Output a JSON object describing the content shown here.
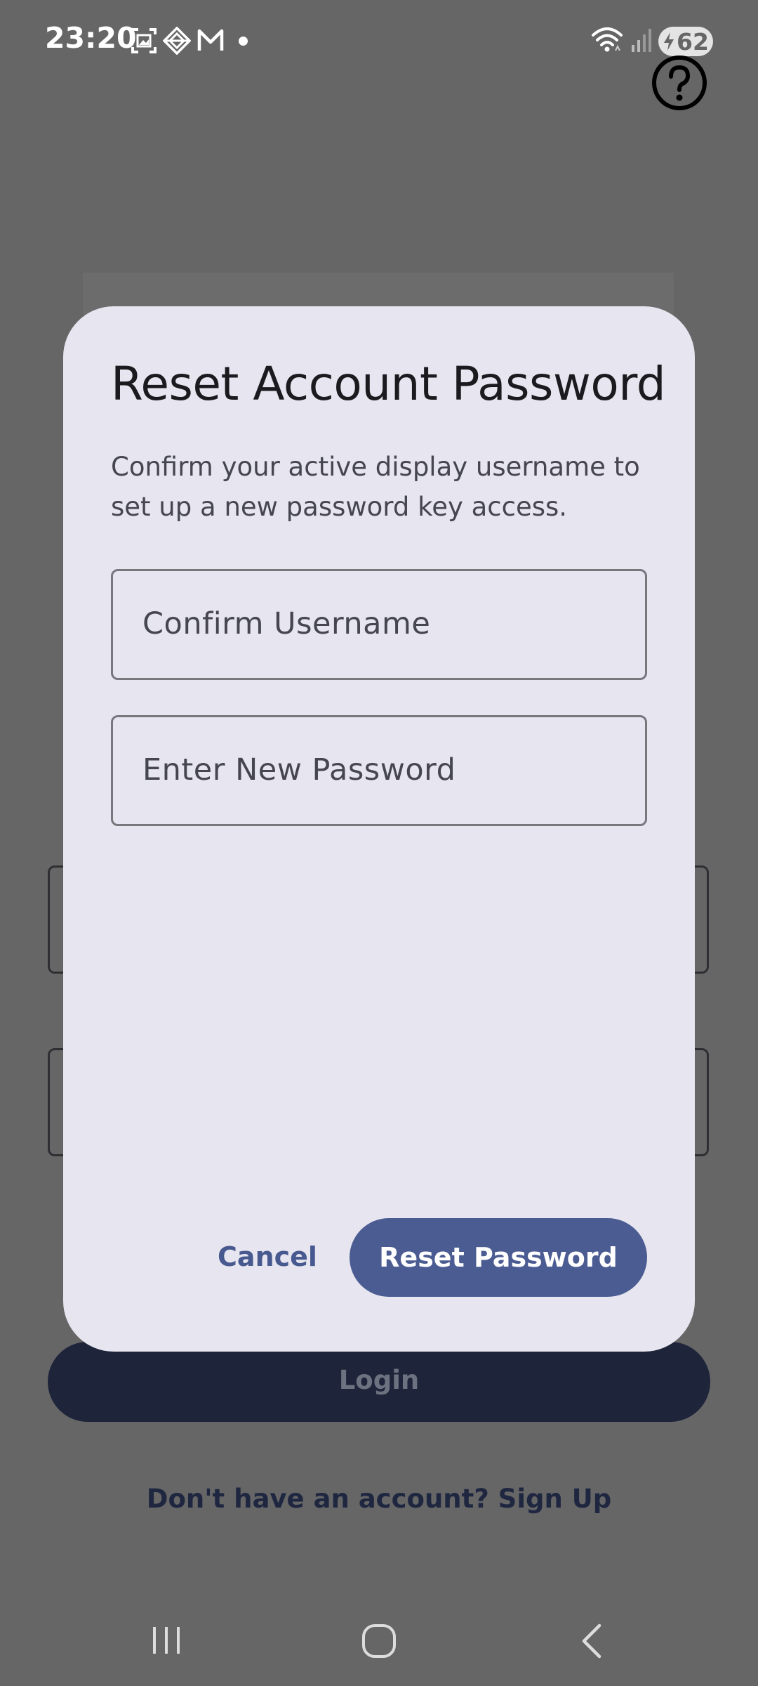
{
  "status_bar": {
    "time": "23:20",
    "battery_level": "62",
    "notification_icons": [
      "screenshot-icon",
      "diamond-app-icon",
      "gmail-icon",
      "more-dot-icon"
    ],
    "system_icons": [
      "wifi-icon",
      "signal-icon",
      "battery-charging-icon"
    ]
  },
  "header": {
    "help_icon": "help-circle-icon"
  },
  "background": {
    "login_button_label": "Login",
    "signup_prompt": "Don't have an account? Sign Up"
  },
  "dialog": {
    "title": "Reset Account Password",
    "message": "Confirm your active display username to set up a new password key access.",
    "username_field": {
      "placeholder": "Confirm Username",
      "value": ""
    },
    "password_field": {
      "placeholder": "Enter New Password",
      "value": ""
    },
    "cancel_label": "Cancel",
    "confirm_label": "Reset Password"
  },
  "colors": {
    "scrim": "#666667",
    "dialog_bg": "#e7e5ef",
    "primary": "#4a5c92",
    "login_button": "#1e253a"
  },
  "nav_bar": {
    "buttons": [
      "recent-apps-icon",
      "home-icon",
      "back-icon"
    ]
  }
}
